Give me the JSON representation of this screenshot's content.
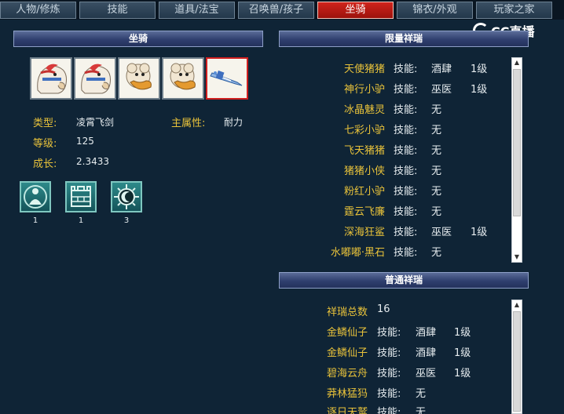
{
  "tabs": [
    {
      "label": "人物/修炼",
      "active": false
    },
    {
      "label": "技能",
      "active": false
    },
    {
      "label": "道具/法宝",
      "active": false
    },
    {
      "label": "召唤兽/孩子",
      "active": false
    },
    {
      "label": "坐骑",
      "active": true
    },
    {
      "label": "锦衣/外观",
      "active": false
    },
    {
      "label": "玩家之家",
      "active": false
    }
  ],
  "logo": {
    "text": "CC直播"
  },
  "mount_panel": {
    "header": "坐骑",
    "mounts": [
      {
        "icon": "horse-mount-icon",
        "selected": false
      },
      {
        "icon": "horse-mount-icon",
        "selected": false
      },
      {
        "icon": "sheep-mount-icon",
        "selected": false
      },
      {
        "icon": "sheep-mount-icon",
        "selected": false
      },
      {
        "icon": "flying-sword-mount-icon",
        "selected": true
      }
    ],
    "attrs": {
      "type_label": "类型:",
      "type_value": "凌霄飞剑",
      "main_attr_label": "主属性:",
      "main_attr_value": "耐力",
      "level_label": "等级:",
      "level_value": "125",
      "growth_label": "成长:",
      "growth_value": "2.3433"
    },
    "skills": [
      {
        "icon": "meditation-skill-icon",
        "count": "1"
      },
      {
        "icon": "fortress-skill-icon",
        "count": "1"
      },
      {
        "icon": "crescent-sun-skill-icon",
        "count": "3"
      }
    ]
  },
  "limited_panel": {
    "header": "限量祥瑞",
    "rows": [
      {
        "name": "天使猪猪",
        "skill_label": "技能:",
        "skill": "酒肆",
        "level": "1级"
      },
      {
        "name": "神行小驴",
        "skill_label": "技能:",
        "skill": "巫医",
        "level": "1级"
      },
      {
        "name": "冰晶魅灵",
        "skill_label": "技能:",
        "skill": "无",
        "level": ""
      },
      {
        "name": "七彩小驴",
        "skill_label": "技能:",
        "skill": "无",
        "level": ""
      },
      {
        "name": "飞天猪猪",
        "skill_label": "技能:",
        "skill": "无",
        "level": ""
      },
      {
        "name": "猪猪小侠",
        "skill_label": "技能:",
        "skill": "无",
        "level": ""
      },
      {
        "name": "粉红小驴",
        "skill_label": "技能:",
        "skill": "无",
        "level": ""
      },
      {
        "name": "霆云飞廉",
        "skill_label": "技能:",
        "skill": "无",
        "level": ""
      },
      {
        "name": "深海狂鲨",
        "skill_label": "技能:",
        "skill": "巫医",
        "level": "1级"
      },
      {
        "name": "水嘟嘟·黑石",
        "skill_label": "技能:",
        "skill": "无",
        "level": ""
      }
    ]
  },
  "normal_panel": {
    "header": "普通祥瑞",
    "total_label": "祥瑞总数",
    "total_value": "16",
    "rows": [
      {
        "name": "金鳞仙子",
        "skill_label": "技能:",
        "skill": "酒肆",
        "level": "1级"
      },
      {
        "name": "金鳞仙子",
        "skill_label": "技能:",
        "skill": "酒肆",
        "level": "1级"
      },
      {
        "name": "碧海云舟",
        "skill_label": "技能:",
        "skill": "巫医",
        "level": "1级"
      },
      {
        "name": "莽林猛犸",
        "skill_label": "技能:",
        "skill": "无",
        "level": ""
      },
      {
        "name": "逐日天鹫",
        "skill_label": "技能:",
        "skill": "无",
        "level": ""
      }
    ]
  },
  "colors": {
    "background": "#0f2436",
    "accent_red": "#d0241c",
    "label_yellow": "#e8c23a",
    "header_blue": "#2f3f6e"
  }
}
